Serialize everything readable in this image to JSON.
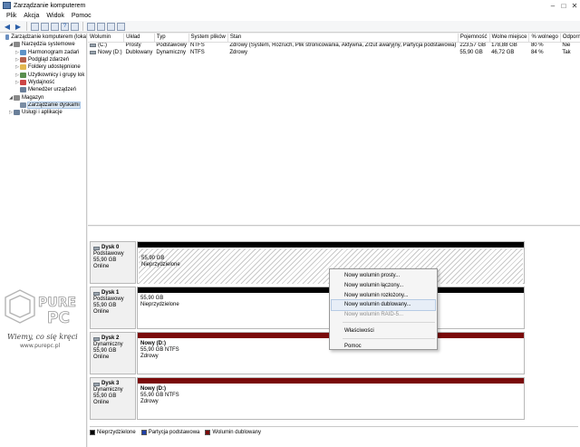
{
  "window": {
    "title": "Zarządzanie komputerem",
    "controls": {
      "minimize": "–",
      "maximize": "□",
      "close": "✕"
    }
  },
  "menubar": {
    "items": [
      "Plik",
      "Akcja",
      "Widok",
      "Pomoc"
    ]
  },
  "toolbar": {
    "back": "◀",
    "forward": "▶",
    "help": "?"
  },
  "tree": {
    "items": [
      {
        "label": "Zarządzanie komputerem (loka",
        "indent": 0,
        "expander": "",
        "icon": "computer-icon",
        "color": "#6a8fc0"
      },
      {
        "label": "Narzędzia systemowe",
        "indent": 1,
        "expander": "◢",
        "icon": "tools-icon",
        "color": "#8a8a8a"
      },
      {
        "label": "Harmonogram zadań",
        "indent": 2,
        "expander": "▷",
        "icon": "clock-icon",
        "color": "#5d93c7"
      },
      {
        "label": "Podgląd zdarzeń",
        "indent": 2,
        "expander": "▷",
        "icon": "event-viewer-icon",
        "color": "#b5604a"
      },
      {
        "label": "Foldery udostępnione",
        "indent": 2,
        "expander": "▷",
        "icon": "shared-folder-icon",
        "color": "#e3b84f"
      },
      {
        "label": "Użytkownicy i grupy lok",
        "indent": 2,
        "expander": "▷",
        "icon": "users-icon",
        "color": "#5a8f4e"
      },
      {
        "label": "Wydajność",
        "indent": 2,
        "expander": "▷",
        "icon": "performance-icon",
        "color": "#c44"
      },
      {
        "label": "Menedżer urządzeń",
        "indent": 2,
        "expander": "",
        "icon": "device-manager-icon",
        "color": "#6a7f99"
      },
      {
        "label": "Magazyn",
        "indent": 1,
        "expander": "◢",
        "icon": "storage-icon",
        "color": "#8a8a8a"
      },
      {
        "label": "Zarządzanie dyskami",
        "indent": 2,
        "expander": "",
        "icon": "disk-management-icon",
        "color": "#7a8da4",
        "selected": true
      },
      {
        "label": "Usługi i aplikacje",
        "indent": 1,
        "expander": "▷",
        "icon": "services-icon",
        "color": "#6a7f99"
      }
    ]
  },
  "volumes": {
    "columns": [
      "Wolumin",
      "Układ",
      "Typ",
      "System plików",
      "Stan",
      "Pojemność",
      "Wolne miejsce",
      "% wolnego",
      "Odporność na"
    ],
    "rows": [
      [
        "(C:)",
        "Prosty",
        "Podstawowy",
        "NTFS",
        "Zdrowy (System, Rozruch, Plik stronicowania, Aktywna, Zrzut awaryjny, Partycja podstawowa)",
        "223,57 GB",
        "178,88 GB",
        "80 %",
        "Nie"
      ],
      [
        "Nowy (D:)",
        "Dublowany",
        "Dynamiczny",
        "NTFS",
        "Zdrowy",
        "55,90 GB",
        "46,72 GB",
        "84 %",
        "Tak"
      ]
    ]
  },
  "disks": [
    {
      "name": "Dysk 0",
      "type": "Podstawowy",
      "size": "55,90 GB",
      "status": "Online",
      "bar_color": "#000000",
      "part_name": "",
      "part_size": "55,90 GB",
      "part_status": "Nieprzydzielone",
      "hatched": true
    },
    {
      "name": "Dysk 1",
      "type": "Podstawowy",
      "size": "55,90 GB",
      "status": "Online",
      "bar_color": "#000000",
      "part_name": "",
      "part_size": "55,90 GB",
      "part_status": "Nieprzydzielone",
      "hatched": false
    },
    {
      "name": "Dysk 2",
      "type": "Dynamiczny",
      "size": "55,90 GB",
      "status": "Online",
      "bar_color": "#7a0a0a",
      "part_name": "Nowy (D:)",
      "part_size": "55,90 GB NTFS",
      "part_status": "Zdrowy",
      "hatched": false
    },
    {
      "name": "Dysk 3",
      "type": "Dynamiczny",
      "size": "55,90 GB",
      "status": "Online",
      "bar_color": "#7a0a0a",
      "part_name": "Nowy (D:)",
      "part_size": "55,90 GB NTFS",
      "part_status": "Zdrowy",
      "hatched": false
    }
  ],
  "legend": [
    {
      "label": "Nieprzydzielone",
      "color": "#000000"
    },
    {
      "label": "Partycja podstawowa",
      "color": "#1f3fa8"
    },
    {
      "label": "Wolumin dublowany",
      "color": "#7a0a0a"
    }
  ],
  "context_menu": {
    "items": [
      {
        "label": "Nowy wolumin prosty...",
        "disabled": false,
        "highlighted": false
      },
      {
        "label": "Nowy wolumin łączony...",
        "disabled": false,
        "highlighted": false
      },
      {
        "label": "Nowy wolumin rozłożony...",
        "disabled": false,
        "highlighted": false
      },
      {
        "label": "Nowy wolumin dublowany...",
        "disabled": false,
        "highlighted": true
      },
      {
        "label": "Nowy wolumin RAID-5...",
        "disabled": true,
        "highlighted": false
      }
    ],
    "properties": "Właściwości",
    "help": "Pomoc"
  },
  "watermark": {
    "logo_text": "PURE PC",
    "tagline": "Wiemy, co się kręci",
    "url": "www.purepc.pl"
  }
}
